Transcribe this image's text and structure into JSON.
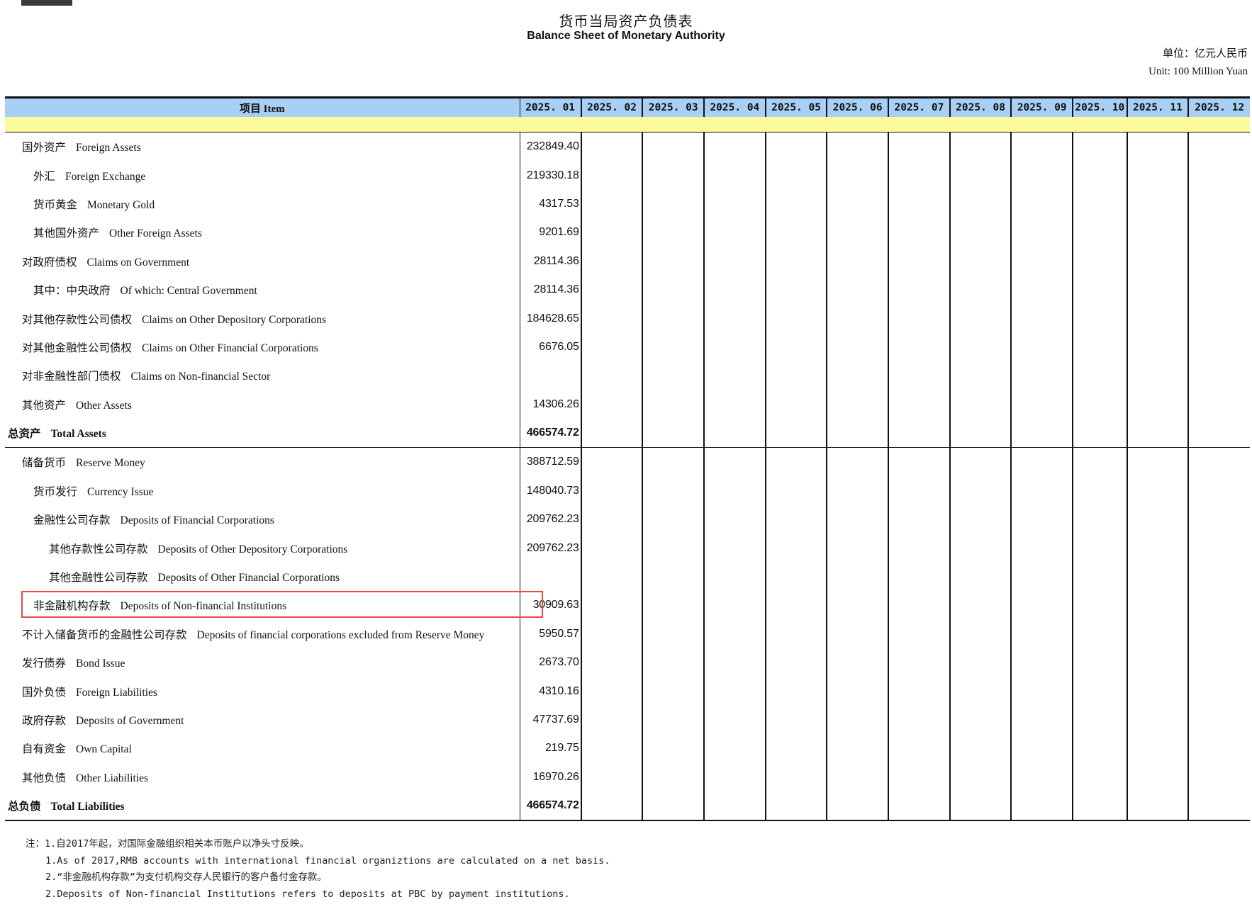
{
  "title_cn": "货币当局资产负债表",
  "title_en": "Balance Sheet of  Monetary Authority",
  "unit_cn": "单位：亿元人民币",
  "unit_en": "Unit: 100 Million Yuan",
  "header": {
    "item": "项目  Item",
    "months": [
      "2025. 01",
      "2025. 02",
      "2025. 03",
      "2025. 04",
      "2025. 05",
      "2025. 06",
      "2025. 07",
      "2025. 08",
      "2025. 09",
      "2025. 10",
      "2025. 11",
      "2025. 12"
    ]
  },
  "assets": [
    {
      "cn": "国外资产",
      "en": "Foreign Assets",
      "value": "232849.40",
      "level": 1
    },
    {
      "cn": "外汇",
      "en": "Foreign Exchange",
      "value": "219330.18",
      "level": 2
    },
    {
      "cn": "货币黄金",
      "en": "Monetary Gold",
      "value": "4317.53",
      "level": 2
    },
    {
      "cn": "其他国外资产",
      "en": "Other Foreign Assets",
      "value": "9201.69",
      "level": 2
    },
    {
      "cn": "对政府债权",
      "en": "Claims on Government",
      "value": "28114.36",
      "level": 1
    },
    {
      "cn": "其中：中央政府",
      "en": "Of which: Central Government",
      "value": "28114.36",
      "level": 2
    },
    {
      "cn": "对其他存款性公司债权",
      "en": "Claims on Other Depository Corporations",
      "value": "184628.65",
      "level": 1
    },
    {
      "cn": "对其他金融性公司债权",
      "en": "Claims on Other Financial Corporations",
      "value": "6676.05",
      "level": 1
    },
    {
      "cn": "对非金融性部门债权",
      "en": "Claims on Non-financial Sector",
      "value": "",
      "level": 1
    },
    {
      "cn": "其他资产",
      "en": "Other Assets",
      "value": "14306.26",
      "level": 1
    }
  ],
  "total_assets": {
    "cn": "总资产",
    "en": "Total Assets",
    "value": "466574.72"
  },
  "liabilities": [
    {
      "cn": "储备货币",
      "en": "Reserve Money",
      "value": "388712.59",
      "level": 1
    },
    {
      "cn": "货币发行",
      "en": "Currency Issue",
      "value": "148040.73",
      "level": 2
    },
    {
      "cn": "金融性公司存款",
      "en": "Deposits of  Financial Corporations",
      "value": "209762.23",
      "level": 2
    },
    {
      "cn": "其他存款性公司存款",
      "en": "Deposits of  Other Depository Corporations",
      "value": "209762.23",
      "level": 3
    },
    {
      "cn": "其他金融性公司存款",
      "en": "Deposits of  Other Financial Corporations",
      "value": "",
      "level": 3
    },
    {
      "cn": "非金融机构存款",
      "en": "Deposits of  Non-financial Institutions",
      "value": "30909.63",
      "level": 2
    },
    {
      "cn": "不计入储备货币的金融性公司存款",
      "en": "Deposits of financial corporations excluded from Reserve Money",
      "value": "5950.57",
      "level": 1
    },
    {
      "cn": "发行债券",
      "en": "Bond Issue",
      "value": "2673.70",
      "level": 1
    },
    {
      "cn": "国外负债",
      "en": "Foreign Liabilities",
      "value": "4310.16",
      "level": 1
    },
    {
      "cn": "政府存款",
      "en": "Deposits of Government",
      "value": "47737.69",
      "level": 1
    },
    {
      "cn": "自有资金",
      "en": "Own Capital",
      "value": "219.75",
      "level": 1
    },
    {
      "cn": "其他负债",
      "en": "Other Liabilities",
      "value": "16970.26",
      "level": 1
    }
  ],
  "total_liabilities": {
    "cn": "总负债",
    "en": "Total Liabilities",
    "value": "466574.72"
  },
  "notes": [
    "注：1.自2017年起，对国际金融组织相关本币账户以净头寸反映。",
    "1.As of 2017,RMB accounts with international financial organiztions are calculated on a net basis.",
    "2.“非金融机构存款”为支付机构交存人民银行的客户备付金存款。",
    "2.Deposits of Non-financial Institutions refers to deposits at PBC by payment institutions."
  ],
  "highlight_color": "#e84848",
  "header_color": "#a8d0f7",
  "band_color": "#fbfb9c"
}
